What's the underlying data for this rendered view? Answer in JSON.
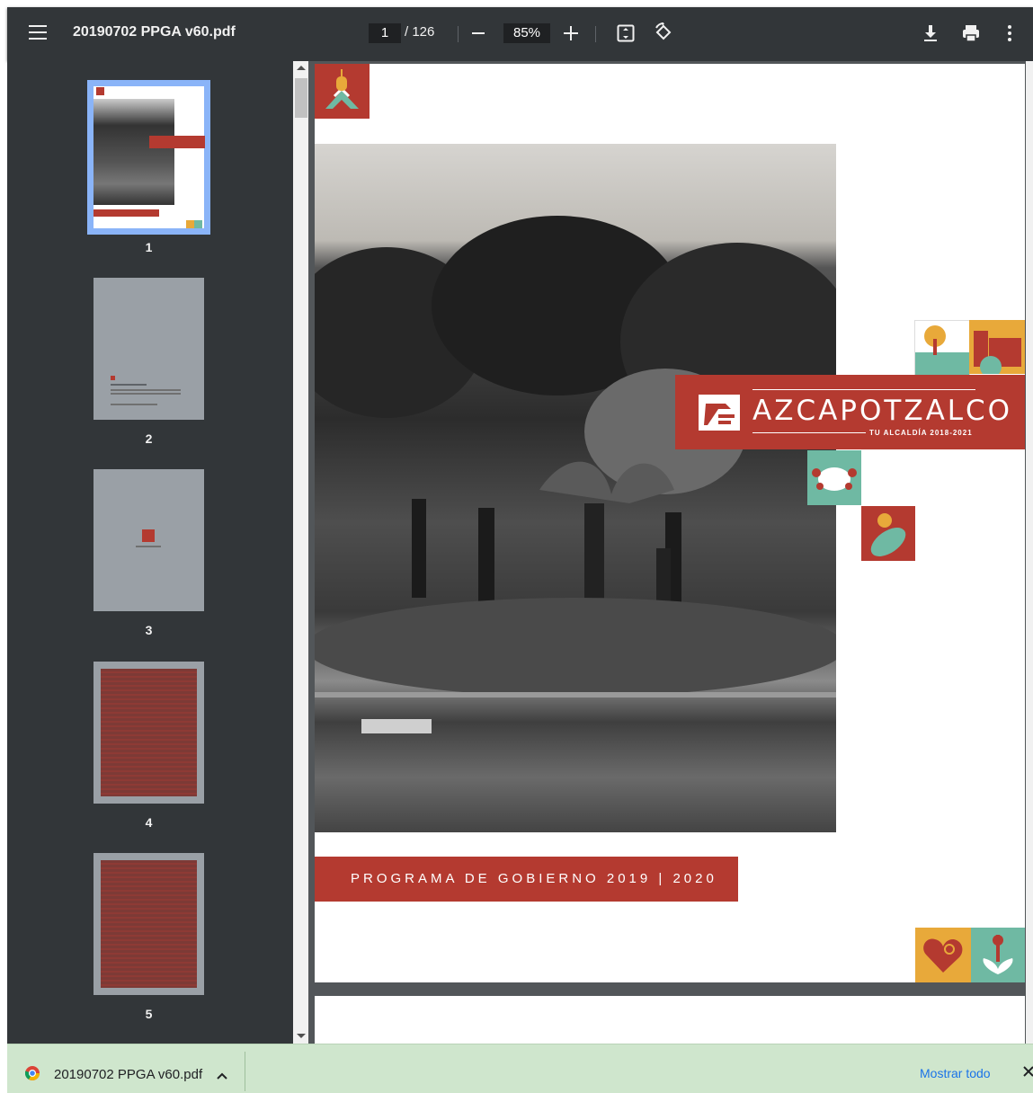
{
  "toolbar": {
    "title": "20190702 PPGA v60.pdf",
    "current_page": "1",
    "total_pages": "/ 126",
    "zoom": "85%"
  },
  "sidebar": {
    "thumbnails": [
      {
        "number": "1",
        "selected": true
      },
      {
        "number": "2"
      },
      {
        "number": "3"
      },
      {
        "number": "4"
      },
      {
        "number": "5"
      }
    ]
  },
  "page": {
    "brand": "AZCAPOTZALCO",
    "brand_tagline": "TU ALCALDÍA 2018-2021",
    "program_title": "PROGRAMA DE GOBIERNO 2019 | 2020"
  },
  "download_bar": {
    "file_name": "20190702 PPGA v60.pdf",
    "show_all": "Mostrar todo"
  },
  "colors": {
    "toolbar": "#323639",
    "brand_red": "#b43a30",
    "teal": "#6fb9a3",
    "yellow": "#e8a93a",
    "download_bar": "#cfe6cd",
    "link": "#1a73e8"
  }
}
